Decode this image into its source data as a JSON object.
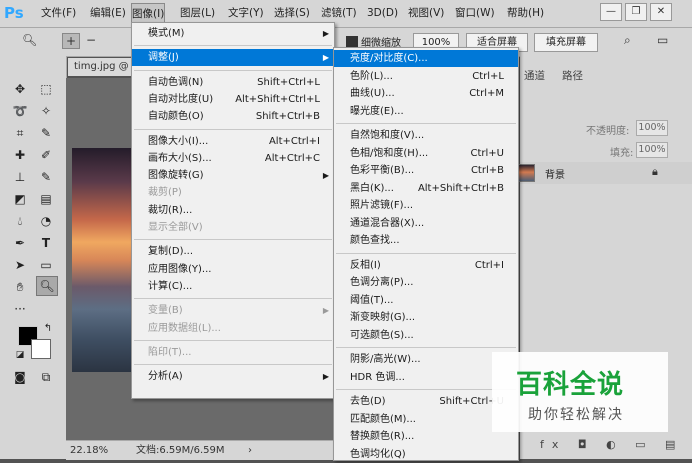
{
  "app": {
    "logo": "Ps",
    "accent": "#31a8ff"
  },
  "menubar": {
    "items": [
      "文件(F)",
      "编辑(E)",
      "图像(I)",
      "图层(L)",
      "文字(Y)",
      "选择(S)",
      "滤镜(T)",
      "3D(D)",
      "视图(V)",
      "窗口(W)",
      "帮助(H)"
    ],
    "active_index": 2,
    "window_buttons": [
      "—",
      "❐",
      "✕"
    ]
  },
  "options": {
    "checkbox_label": "细微缩放",
    "zoom_percent": "100%",
    "fit_screen": "适合屏幕",
    "fill_screen": "填充屏幕"
  },
  "document": {
    "tab_title": "timg.jpg @ 2",
    "zoom": "22.18%",
    "doc_size": "文档:6.59M/6.59M"
  },
  "panels": {
    "tabs": [
      "通道",
      "路径"
    ],
    "opacity_label": "不透明度:",
    "opacity_value": "100%",
    "fill_label": "填充:",
    "fill_value": "100%",
    "layer_name": "背景"
  },
  "image_menu": {
    "items": [
      {
        "label": "模式(M)",
        "shortcut": "",
        "submenu": true,
        "disabled": false
      },
      {
        "sep": true
      },
      {
        "label": "调整(J)",
        "shortcut": "",
        "submenu": true,
        "disabled": false,
        "highlight": true
      },
      {
        "sep": true
      },
      {
        "label": "自动色调(N)",
        "shortcut": "Shift+Ctrl+L"
      },
      {
        "label": "自动对比度(U)",
        "shortcut": "Alt+Shift+Ctrl+L"
      },
      {
        "label": "自动颜色(O)",
        "shortcut": "Shift+Ctrl+B"
      },
      {
        "sep": true
      },
      {
        "label": "图像大小(I)...",
        "shortcut": "Alt+Ctrl+I"
      },
      {
        "label": "画布大小(S)...",
        "shortcut": "Alt+Ctrl+C"
      },
      {
        "label": "图像旋转(G)",
        "shortcut": "",
        "submenu": true
      },
      {
        "label": "裁剪(P)",
        "shortcut": "",
        "disabled": true
      },
      {
        "label": "裁切(R)...",
        "shortcut": ""
      },
      {
        "label": "显示全部(V)",
        "shortcut": "",
        "disabled": true
      },
      {
        "sep": true
      },
      {
        "label": "复制(D)...",
        "shortcut": ""
      },
      {
        "label": "应用图像(Y)...",
        "shortcut": ""
      },
      {
        "label": "计算(C)...",
        "shortcut": ""
      },
      {
        "sep": true
      },
      {
        "label": "变量(B)",
        "shortcut": "",
        "submenu": true,
        "disabled": true
      },
      {
        "label": "应用数据组(L)...",
        "shortcut": "",
        "disabled": true
      },
      {
        "sep": true
      },
      {
        "label": "陷印(T)...",
        "shortcut": "",
        "disabled": true
      },
      {
        "sep": true
      },
      {
        "label": "分析(A)",
        "shortcut": "",
        "submenu": true
      }
    ]
  },
  "adjust_menu": {
    "items": [
      {
        "label": "亮度/对比度(C)...",
        "shortcut": "",
        "highlight": true
      },
      {
        "label": "色阶(L)...",
        "shortcut": "Ctrl+L"
      },
      {
        "label": "曲线(U)...",
        "shortcut": "Ctrl+M"
      },
      {
        "label": "曝光度(E)...",
        "shortcut": ""
      },
      {
        "sep": true
      },
      {
        "label": "自然饱和度(V)...",
        "shortcut": ""
      },
      {
        "label": "色相/饱和度(H)...",
        "shortcut": "Ctrl+U"
      },
      {
        "label": "色彩平衡(B)...",
        "shortcut": "Ctrl+B"
      },
      {
        "label": "黑白(K)...",
        "shortcut": "Alt+Shift+Ctrl+B"
      },
      {
        "label": "照片滤镜(F)...",
        "shortcut": ""
      },
      {
        "label": "通道混合器(X)...",
        "shortcut": ""
      },
      {
        "label": "颜色查找...",
        "shortcut": ""
      },
      {
        "sep": true
      },
      {
        "label": "反相(I)",
        "shortcut": "Ctrl+I"
      },
      {
        "label": "色调分离(P)...",
        "shortcut": ""
      },
      {
        "label": "阈值(T)...",
        "shortcut": ""
      },
      {
        "label": "渐变映射(G)...",
        "shortcut": ""
      },
      {
        "label": "可选颜色(S)...",
        "shortcut": ""
      },
      {
        "sep": true
      },
      {
        "label": "阴影/高光(W)...",
        "shortcut": ""
      },
      {
        "label": "HDR 色调...",
        "shortcut": ""
      },
      {
        "sep": true
      },
      {
        "label": "去色(D)",
        "shortcut": "Shift+Ctrl+U"
      },
      {
        "label": "匹配颜色(M)...",
        "shortcut": ""
      },
      {
        "label": "替换颜色(R)...",
        "shortcut": ""
      },
      {
        "label": "色调均化(Q)",
        "shortcut": ""
      }
    ]
  },
  "watermark": {
    "title": "百科全说",
    "subtitle": "助你轻松解决",
    "color": "#1aa23a"
  }
}
